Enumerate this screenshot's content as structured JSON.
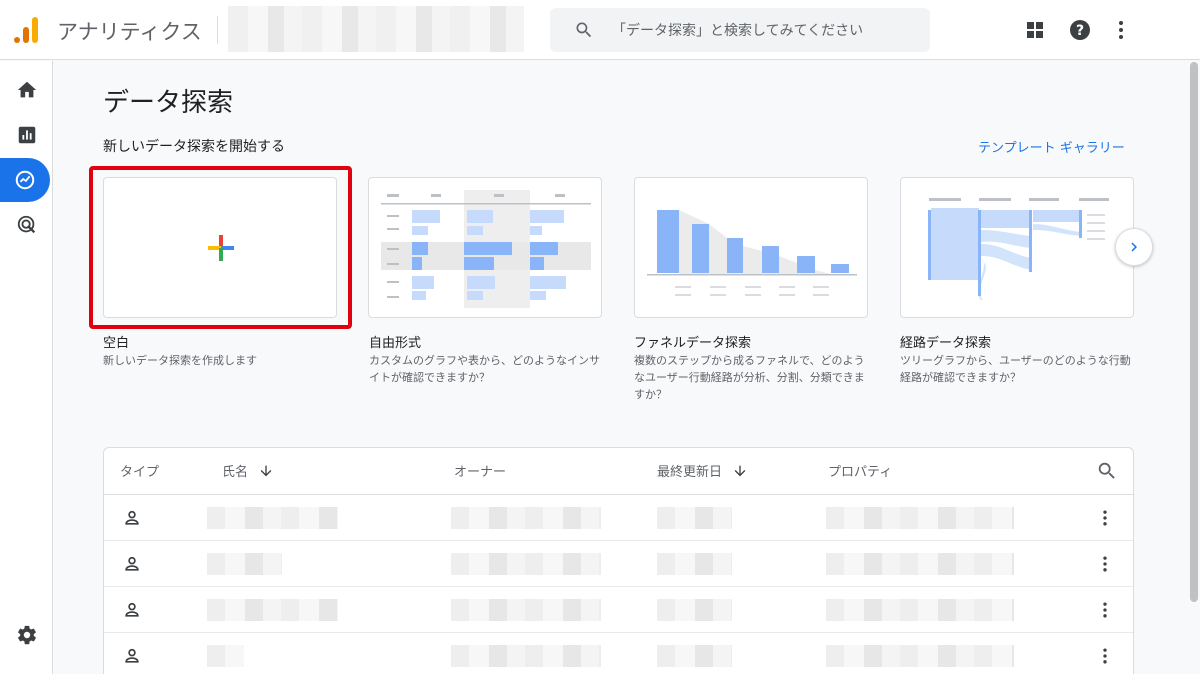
{
  "header": {
    "app_title": "アナリティクス",
    "search_placeholder": "「データ探索」と検索してみてください"
  },
  "page": {
    "title": "データ探索",
    "section_label": "新しいデータ探索を開始する",
    "gallery_link": "テンプレート ギャラリー"
  },
  "templates": [
    {
      "title": "空白",
      "description": "新しいデータ探索を作成します"
    },
    {
      "title": "自由形式",
      "description": "カスタムのグラフや表から、どのようなインサイトが確認できますか？"
    },
    {
      "title": "ファネルデータ探索",
      "description": "複数のステップから成るファネルで、どのようなユーザー行動経路が分析、分割、分類できますか？"
    },
    {
      "title": "経路データ探索",
      "description": "ツリーグラフから、ユーザーのどのような行動経路が確認できますか？"
    }
  ],
  "table": {
    "columns": [
      "タイプ",
      "氏名",
      "オーナー",
      "最終更新日",
      "プロパティ"
    ]
  },
  "colors": {
    "accent": "#1a73e8",
    "highlight": "#e0000f",
    "plus_red": "#ea4335",
    "plus_blue": "#4285f4",
    "plus_yellow": "#fbbc04",
    "plus_green": "#34a853"
  },
  "icons": {
    "rail": [
      "home-icon",
      "reports-icon",
      "explore-icon",
      "advertising-icon",
      "settings-icon"
    ],
    "top": [
      "search-icon",
      "apps-grid-icon",
      "help-icon",
      "more-vert-icon"
    ],
    "row": [
      "person-icon",
      "more-vert-icon"
    ]
  }
}
